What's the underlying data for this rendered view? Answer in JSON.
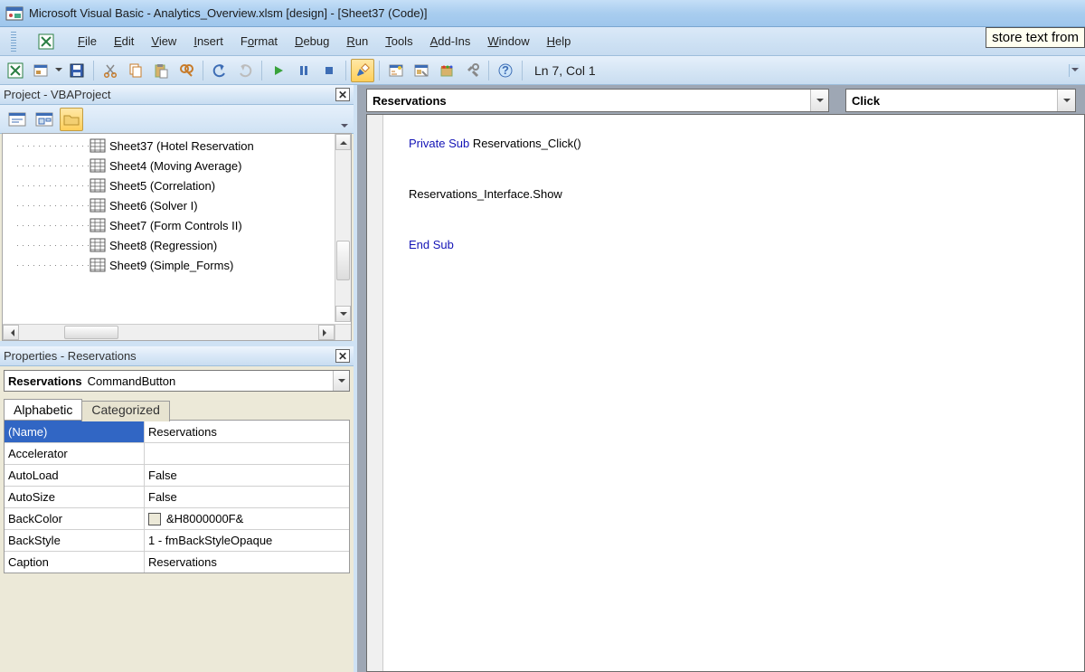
{
  "title": "Microsoft Visual Basic - Analytics_Overview.xlsm [design] - [Sheet37 (Code)]",
  "menu": {
    "file": "File",
    "edit": "Edit",
    "view": "View",
    "insert": "Insert",
    "format": "Format",
    "debug": "Debug",
    "run": "Run",
    "tools": "Tools",
    "addins": "Add-Ins",
    "window": "Window",
    "help": "Help"
  },
  "store_tip": "store text from",
  "toolbar": {
    "cursor_pos": "Ln 7, Col 1"
  },
  "project": {
    "title": "Project - VBAProject",
    "items": [
      "Sheet37 (Hotel Reservation",
      "Sheet4 (Moving Average)",
      "Sheet5 (Correlation)",
      "Sheet6 (Solver I)",
      "Sheet7 (Form Controls II)",
      "Sheet8 (Regression)",
      "Sheet9 (Simple_Forms)"
    ]
  },
  "properties": {
    "title": "Properties - Reservations",
    "object_name": "Reservations",
    "object_type": "CommandButton",
    "tab_alpha": "Alphabetic",
    "tab_cat": "Categorized",
    "rows": [
      {
        "name": "(Name)",
        "value": "Reservations",
        "selected": true
      },
      {
        "name": "Accelerator",
        "value": ""
      },
      {
        "name": "AutoLoad",
        "value": "False"
      },
      {
        "name": "AutoSize",
        "value": "False"
      },
      {
        "name": "BackColor",
        "value": "&H8000000F&",
        "swatch": true
      },
      {
        "name": "BackStyle",
        "value": "1 - fmBackStyleOpaque"
      },
      {
        "name": "Caption",
        "value": "Reservations"
      }
    ]
  },
  "code": {
    "object": "Reservations",
    "procedure": "Click",
    "lines": {
      "l1a": "Private Sub",
      "l1b": " Reservations_Click()",
      "l2": "Reservations_Interface.Show",
      "l3": "End Sub"
    }
  }
}
